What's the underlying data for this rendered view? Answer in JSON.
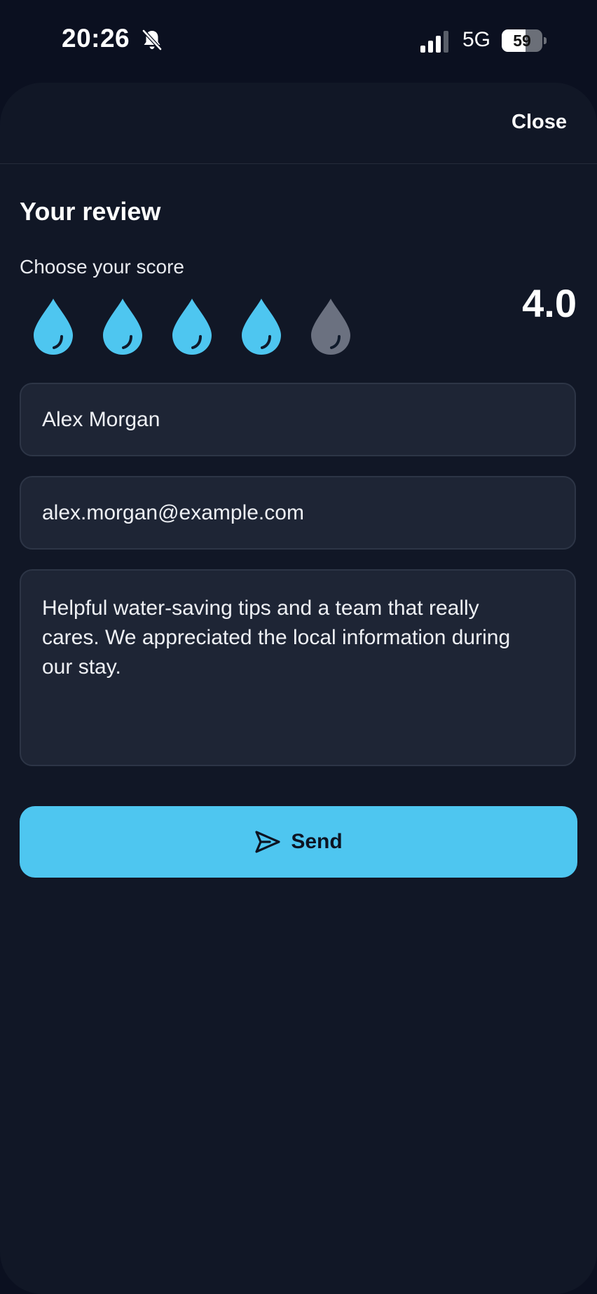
{
  "status_bar": {
    "time": "20:26",
    "silent_icon": "bell-slash-icon",
    "signal_icon": "cellular-signal-icon",
    "network": "5G",
    "battery_level": 59,
    "battery_text": "59"
  },
  "sheet": {
    "close_label": "Close",
    "title": "Your review",
    "score_label": "Choose your score",
    "score_value": "4.0",
    "rating": {
      "value": 4,
      "max": 5,
      "icon": "water-drop-icon",
      "active_color": "#4ec6f0",
      "inactive_color": "#6b7180"
    },
    "name_field": {
      "value": "Alex Morgan"
    },
    "email_field": {
      "value": "alex.morgan@example.com"
    },
    "review_field": {
      "value": "Helpful water-saving tips and a team that really cares. We appreciated the local information during our stay."
    },
    "send_button": {
      "label": "Send",
      "icon": "paper-plane-icon",
      "color": "#4ec6f0"
    }
  }
}
